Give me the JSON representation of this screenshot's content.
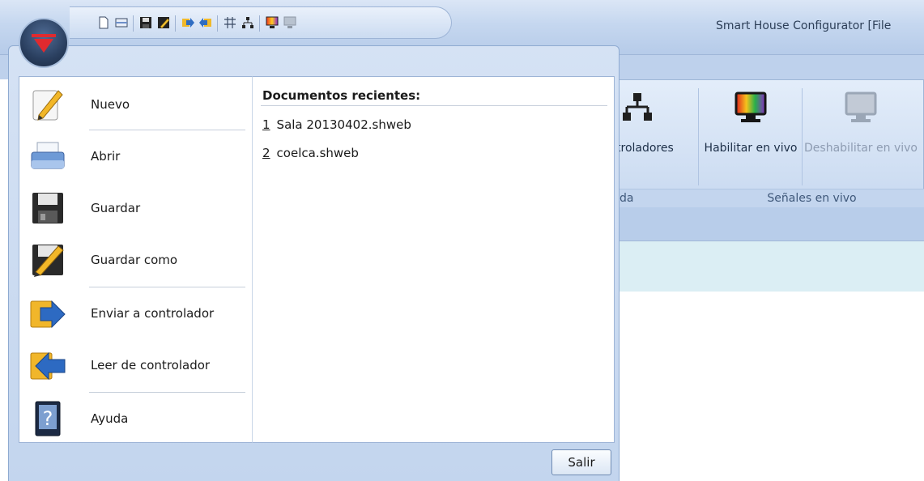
{
  "window": {
    "title": "Smart House Configurator [File"
  },
  "quick_access": {
    "icons": [
      "new-doc-icon",
      "open-icon",
      "save-icon",
      "save-as-icon",
      "send-icon",
      "read-icon",
      "hierarchy-icon",
      "network-icon",
      "live-on-icon",
      "live-off-icon"
    ]
  },
  "ribbon": {
    "controllers_label": "troladores",
    "enable_live_label": "Habilitar en vivo",
    "disable_live_label": "Deshabilitar en vivo",
    "group_left_label": "da",
    "group_live_label": "Señales en vivo"
  },
  "menu": {
    "items": [
      {
        "label": "Nuevo",
        "icon": "pencil-paper-icon"
      },
      {
        "label": "Abrir",
        "icon": "printer-tray-icon"
      },
      {
        "label": "Guardar",
        "icon": "floppy-disk-icon"
      },
      {
        "label": "Guardar como",
        "icon": "floppy-pencil-icon"
      },
      {
        "label": "Enviar a controlador",
        "icon": "folder-arrow-right-icon"
      },
      {
        "label": "Leer de controlador",
        "icon": "folder-arrow-left-icon"
      },
      {
        "label": "Ayuda",
        "icon": "help-book-icon"
      }
    ],
    "recent": {
      "title": "Documentos recientes:",
      "items": [
        {
          "num": "1",
          "name": "Sala 20130402.shweb"
        },
        {
          "num": "2",
          "name": "coelca.shweb"
        }
      ]
    },
    "exit_label": "Salir"
  },
  "colors": {
    "accent": "#c3d5ee",
    "brand_red": "#d8262e"
  }
}
